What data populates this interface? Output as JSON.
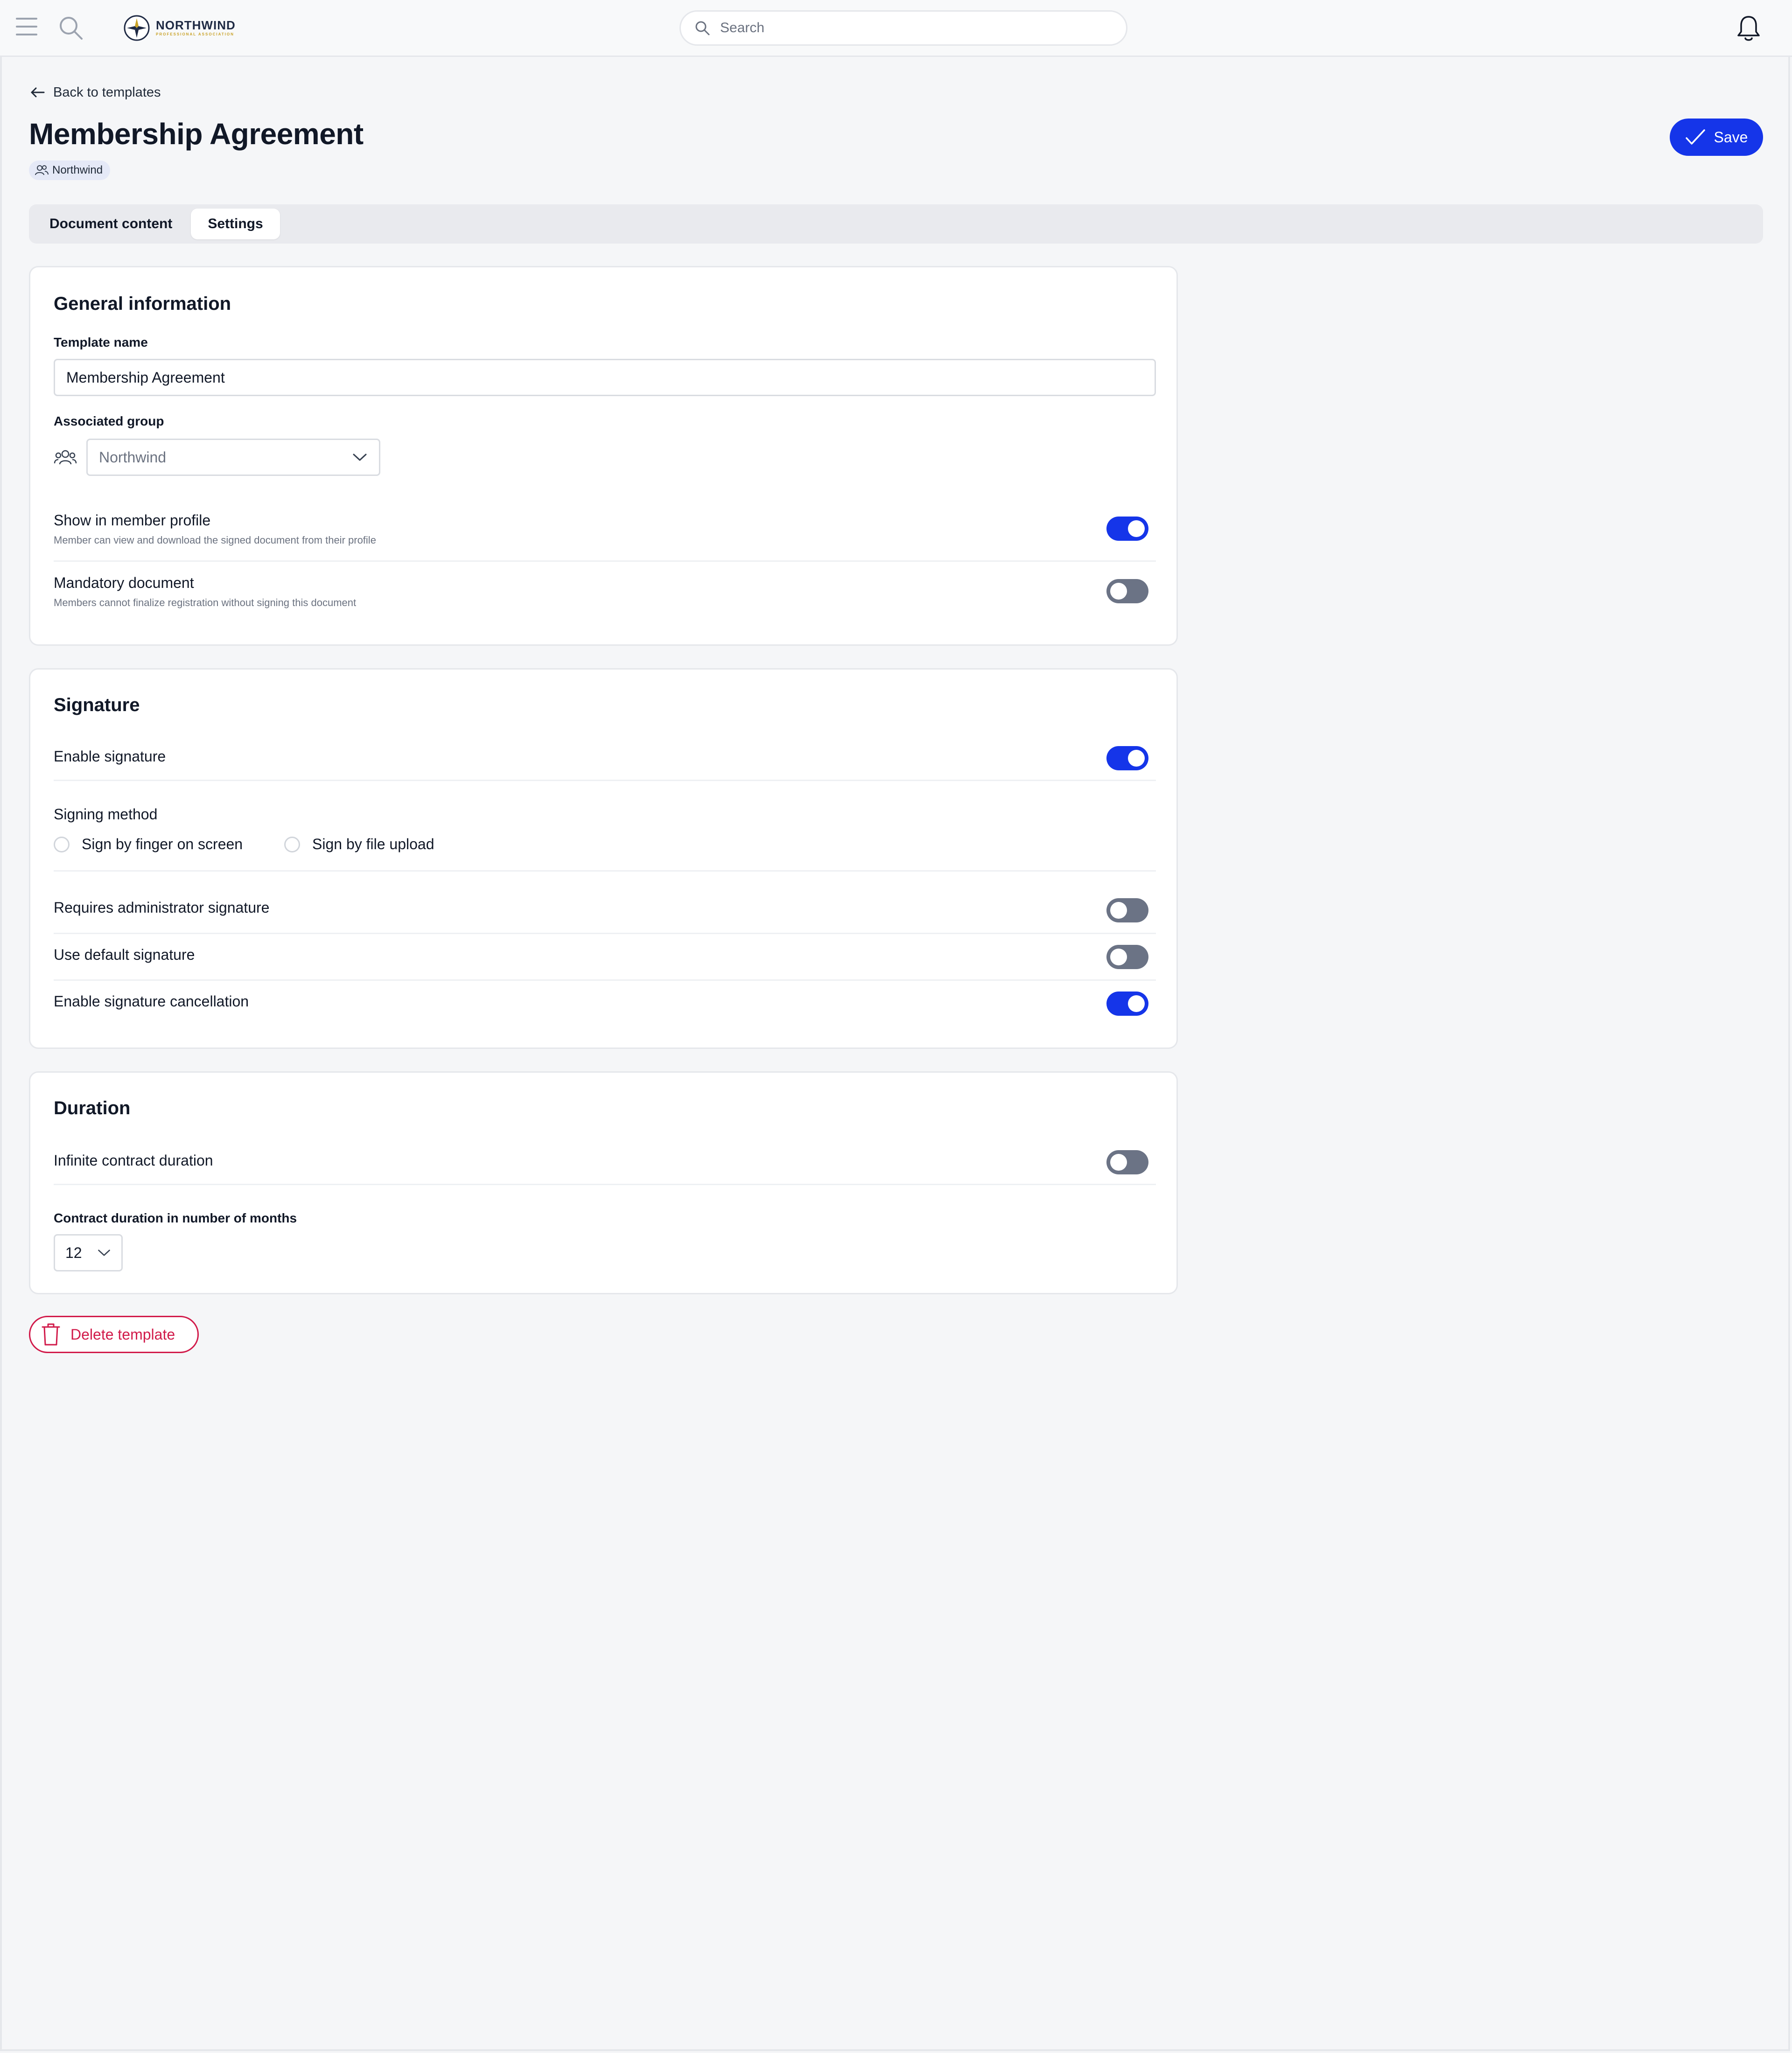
{
  "header": {
    "logo_name": "NORTHWIND",
    "logo_sub": "PROFESSIONAL ASSOCIATION",
    "search_placeholder": "Search",
    "icons": [
      "menu-icon",
      "search-icon",
      "bell-icon"
    ]
  },
  "page": {
    "back_label": "Back to templates",
    "title": "Membership Agreement",
    "group_badge": "Northwind",
    "save_label": "Save"
  },
  "tabs": [
    {
      "label": "Document content",
      "active": false
    },
    {
      "label": "Settings",
      "active": true
    }
  ],
  "general": {
    "title": "General information",
    "template_name_label": "Template name",
    "template_name_value": "Membership Agreement",
    "group_label": "Associated group",
    "group_value": "Northwind",
    "show_profile": {
      "title": "Show in member profile",
      "desc": "Member can view and download the signed document from their profile",
      "on": true
    },
    "mandatory": {
      "title": "Mandatory document",
      "desc": "Members cannot finalize registration without signing this document",
      "on": false
    }
  },
  "signature": {
    "title": "Signature",
    "enable": {
      "title": "Enable signature",
      "on": true
    },
    "method_label": "Signing method",
    "methods": [
      "Sign by finger on screen",
      "Sign by file upload"
    ],
    "admin": {
      "title": "Requires administrator signature",
      "on": false
    },
    "default_sig": {
      "title": "Use default signature",
      "on": false
    },
    "cancellation": {
      "title": "Enable signature cancellation",
      "on": true
    }
  },
  "duration": {
    "title": "Duration",
    "infinite": {
      "title": "Infinite contract duration",
      "on": false
    },
    "months_label": "Contract duration in number of months",
    "months_value": "12"
  },
  "delete_label": "Delete template",
  "colors": {
    "accent": "#1535e9",
    "toggle_off": "#6b7385",
    "danger": "#d11a4a",
    "badge_bg": "#e5e9f7"
  }
}
